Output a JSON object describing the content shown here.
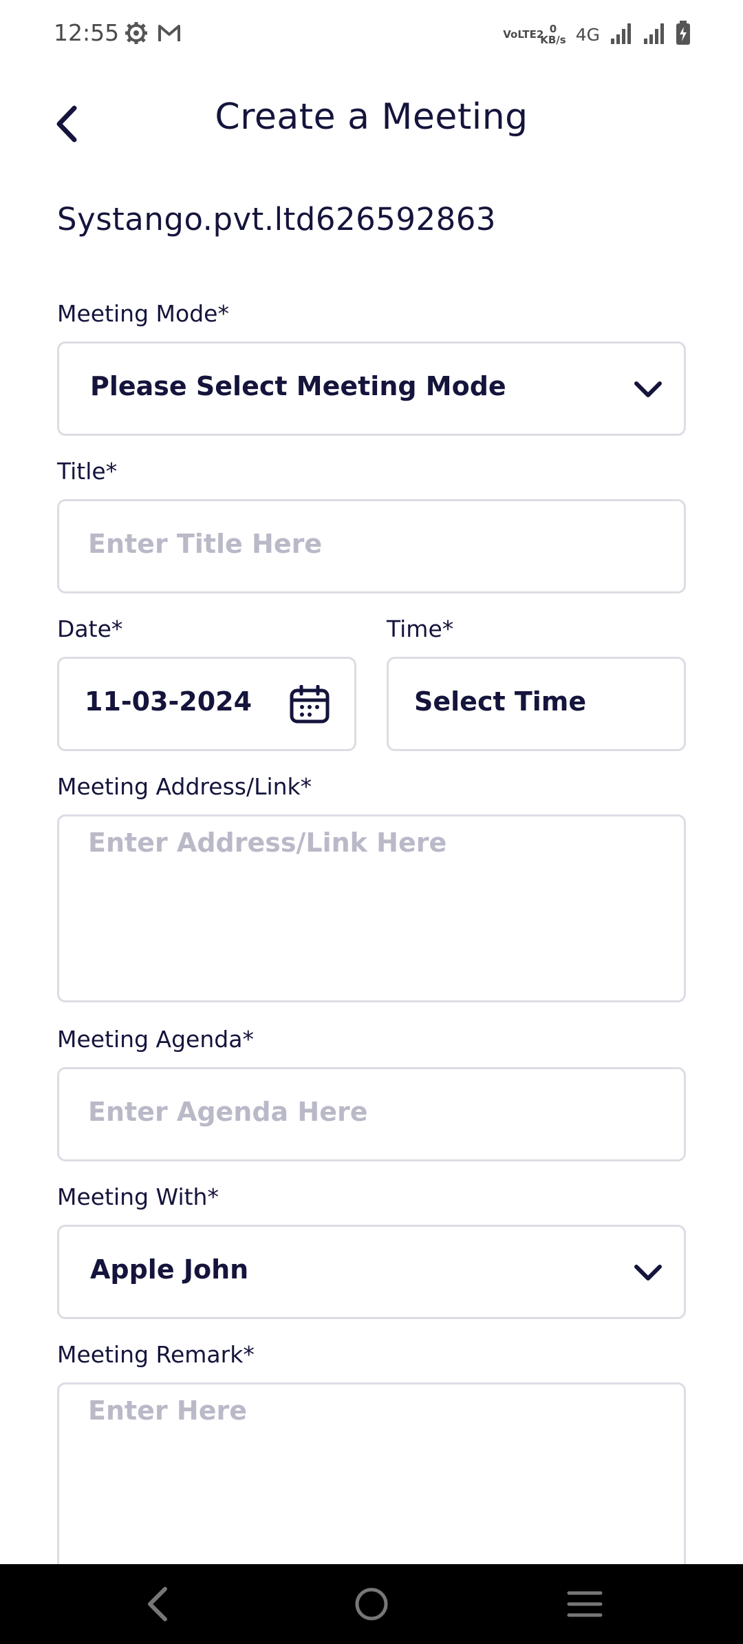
{
  "status_bar": {
    "time": "12:55",
    "icons_left": [
      "settings-icon",
      "gmail-icon"
    ],
    "volte": "VoLTE2",
    "data_rate_value": "0",
    "data_rate_unit": "KB/s",
    "network": "4G"
  },
  "header": {
    "title": "Create a Meeting"
  },
  "organization": "Systango.pvt.ltd626592863",
  "form": {
    "meeting_mode": {
      "label": "Meeting Mode*",
      "value": "Please Select Meeting Mode"
    },
    "title": {
      "label": "Title*",
      "placeholder": "Enter Title Here"
    },
    "date": {
      "label": "Date*",
      "value": "11-03-2024"
    },
    "time": {
      "label": "Time*",
      "value": "Select Time"
    },
    "address": {
      "label": "Meeting Address/Link*",
      "placeholder": "Enter Address/Link Here"
    },
    "agenda": {
      "label": "Meeting Agenda*",
      "placeholder": "Enter Agenda Here"
    },
    "meeting_with": {
      "label": "Meeting With*",
      "value": "Apple John"
    },
    "remark": {
      "label": "Meeting Remark*",
      "placeholder": "Enter Here"
    }
  },
  "colors": {
    "primary_text": "#14143c",
    "placeholder": "#b9b9c8",
    "border": "#dcdce4",
    "nav_bar": "#000000"
  }
}
